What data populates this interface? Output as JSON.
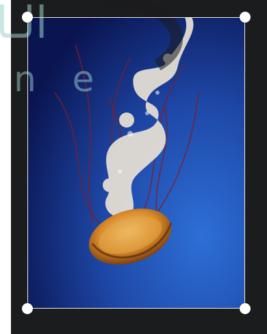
{
  "editor": {
    "background_color": "#1b1c1e",
    "frame_color": "#eaeaea",
    "handle_color": "#ffffff"
  },
  "image": {
    "subject_icon": "jellyfish-image",
    "ocean_colors": [
      "#0a1450",
      "#1e48a8",
      "#2d6fd6"
    ],
    "bell_color": "#d98a2a"
  },
  "watermark": {
    "arabic_text": "الـا",
    "latin_text": "n e",
    "color": "#9ed1cc"
  }
}
